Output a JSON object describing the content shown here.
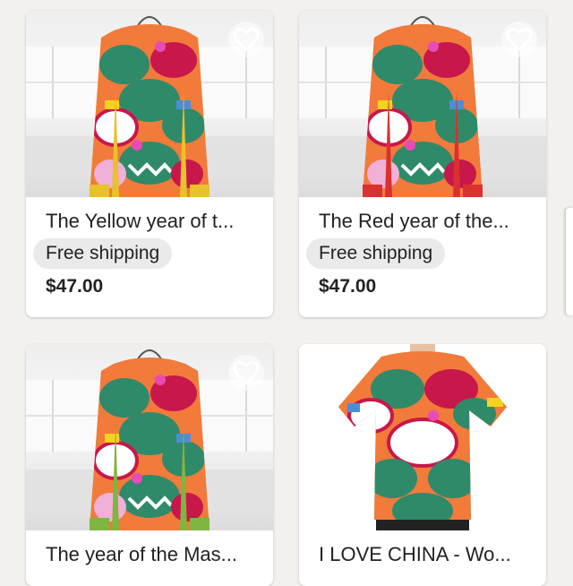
{
  "products": [
    {
      "title": "The Yellow year of t...",
      "shipping": "Free shipping",
      "price": "$47.00",
      "accent_color": "#e8c22a",
      "product_type": "sweatshirt",
      "favorite_icon": "heart-outline-icon"
    },
    {
      "title": "The Red year of the...",
      "shipping": "Free shipping",
      "price": "$47.00",
      "accent_color": "#d93030",
      "product_type": "sweatshirt",
      "favorite_icon": "heart-outline-icon"
    },
    {
      "title": "The year of the Mas...",
      "accent_color": "#7fb541",
      "product_type": "sweatshirt",
      "favorite_icon": "heart-outline-icon"
    },
    {
      "title": "I LOVE CHINA - Wo...",
      "accent_color": "#7fb541",
      "product_type": "t-shirt",
      "favorite_icon": "heart-outline-icon"
    }
  ],
  "colors": {
    "background": "#f3f1ee",
    "card": "#ffffff",
    "badge_bg": "#eaeaea",
    "text": "#222222"
  }
}
